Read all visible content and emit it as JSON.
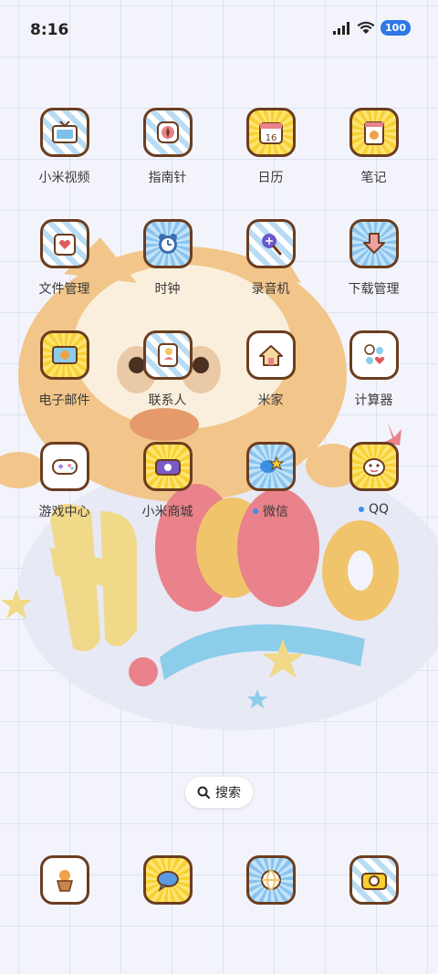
{
  "status_bar": {
    "time": "8:16",
    "battery": "100"
  },
  "wallpaper": {
    "text": "HELLO"
  },
  "apps": [
    [
      {
        "label": "小米视频",
        "icon": "tv-icon",
        "bg": "stripe-blue"
      },
      {
        "label": "指南针",
        "icon": "compass-icon",
        "bg": "stripe-blue"
      },
      {
        "label": "日历",
        "icon": "calendar-icon",
        "bg": "burst-yellow",
        "day": "16"
      },
      {
        "label": "笔记",
        "icon": "notebook-icon",
        "bg": "burst-yellow"
      }
    ],
    [
      {
        "label": "文件管理",
        "icon": "folder-icon",
        "bg": "stripe-blue"
      },
      {
        "label": "时钟",
        "icon": "clock-icon",
        "bg": "burst-blue"
      },
      {
        "label": "录音机",
        "icon": "microphone-icon",
        "bg": "stripe-blue"
      },
      {
        "label": "下载管理",
        "icon": "download-icon",
        "bg": "burst-blue"
      }
    ],
    [
      {
        "label": "电子邮件",
        "icon": "mail-icon",
        "bg": "burst-yellow"
      },
      {
        "label": "联系人",
        "icon": "contacts-icon",
        "bg": "stripe-blue"
      },
      {
        "label": "米家",
        "icon": "home-icon",
        "bg": "plain-white"
      },
      {
        "label": "计算器",
        "icon": "calculator-icon",
        "bg": "plain-white"
      }
    ],
    [
      {
        "label": "游戏中心",
        "icon": "gamepad-icon",
        "bg": "plain-white"
      },
      {
        "label": "小米商城",
        "icon": "shop-icon",
        "bg": "burst-yellow"
      },
      {
        "label": "微信",
        "icon": "wechat-icon",
        "bg": "burst-blue",
        "notification_dot": true
      },
      {
        "label": "QQ",
        "icon": "qq-icon",
        "bg": "burst-yellow",
        "notification_dot": true
      }
    ]
  ],
  "search": {
    "label": "搜索"
  },
  "dock": [
    {
      "icon": "phone-icon",
      "bg": "plain-white"
    },
    {
      "icon": "messages-icon",
      "bg": "burst-yellow"
    },
    {
      "icon": "browser-icon",
      "bg": "burst-blue"
    },
    {
      "icon": "camera-icon",
      "bg": "stripe-blue"
    }
  ]
}
